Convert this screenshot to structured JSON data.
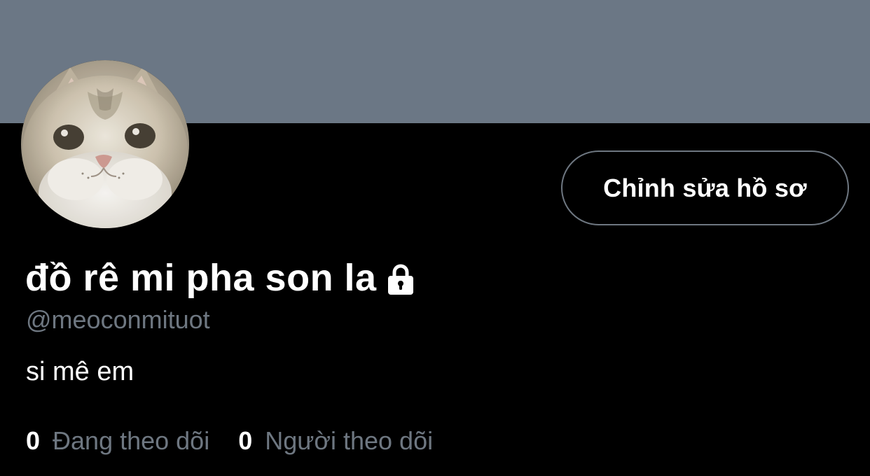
{
  "profile": {
    "display_name": "đồ rê mi pha son la",
    "handle": "@meoconmituot",
    "bio": "si mê em",
    "protected_icon": "lock-icon",
    "avatar": "cat-face-avatar"
  },
  "actions": {
    "edit_profile_label": "Chỉnh sửa hồ sơ"
  },
  "stats": {
    "following_count": "0",
    "following_label": "Đang theo dõi",
    "followers_count": "0",
    "followers_label": "Người theo dõi"
  },
  "colors": {
    "background": "#000000",
    "banner": "#6b7785",
    "primary_text": "#ffffff",
    "secondary_text": "#6e7781",
    "button_border": "#6e7781"
  }
}
